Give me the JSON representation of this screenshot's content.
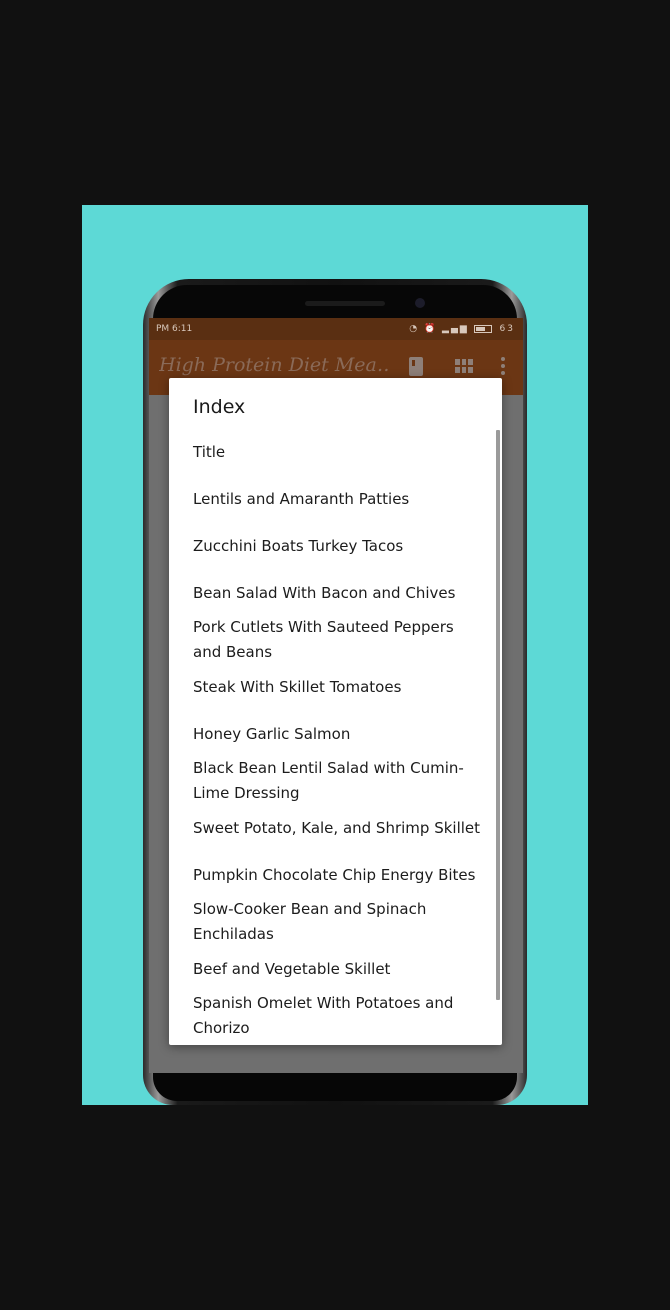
{
  "status_bar": {
    "time": "PM 6:11",
    "battery": "63",
    "icons": [
      "alarm-off-icon",
      "alarm-icon",
      "signal-icon",
      "signal-weak-icon",
      "volte-icon",
      "battery-icon"
    ]
  },
  "app_bar": {
    "title": "High Protein Diet Mea…",
    "actions": [
      "book-icon",
      "grid-icon",
      "more-vert-icon"
    ]
  },
  "dialog": {
    "title": "Index",
    "items": [
      "Title",
      "Lentils and Amaranth Patties",
      "Zucchini Boats Turkey Tacos",
      "Bean Salad With Bacon and Chives",
      "Pork Cutlets With Sauteed Peppers and Beans",
      "Steak With Skillet Tomatoes",
      "Honey Garlic Salmon",
      "Black Bean Lentil Salad with Cumin-Lime Dressing",
      "Sweet Potato, Kale, and Shrimp Skillet",
      "Pumpkin Chocolate Chip Energy Bites",
      "Slow-Cooker Bean and Spinach Enchiladas",
      "Beef and Vegetable Skillet",
      "Spanish Omelet With Potatoes and Chorizo"
    ]
  },
  "colors": {
    "background": "#111111",
    "teal": "#5dd9d6",
    "app_bar": "#6b3614",
    "status_bar": "#5a2f12",
    "dialog": "#ffffff"
  }
}
